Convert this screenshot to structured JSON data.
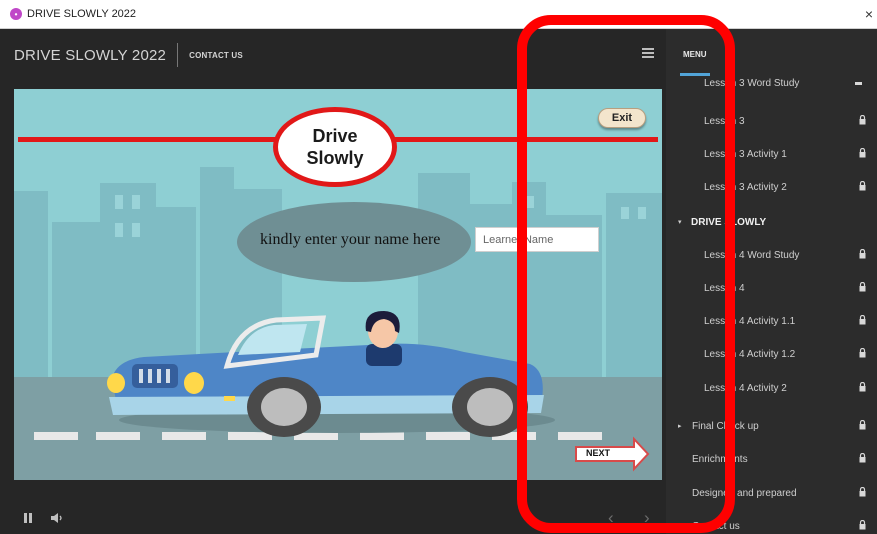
{
  "window": {
    "title": "DRIVE SLOWLY 2022",
    "close_glyph": "×"
  },
  "player": {
    "course_title": "DRIVE SLOWLY 2022",
    "contact_label": "CONTACT US",
    "menu_icon": "hamburger-icon"
  },
  "slide": {
    "title_lines": [
      "Drive",
      "Slowly"
    ],
    "exit_label": "Exit",
    "prompt": "kindly enter your name here",
    "name_input_placeholder": "Learner Name",
    "name_input_value": "",
    "next_label": "NEXT"
  },
  "controls": {
    "prev_glyph": "‹",
    "next_glyph": "›"
  },
  "menu": {
    "title": "MENU",
    "items": [
      {
        "label": "Lesson 3 Word Study",
        "locked": false
      },
      {
        "label": "Lesson 3",
        "locked": true
      },
      {
        "label": "Lesson 3 Activity 1",
        "locked": true
      },
      {
        "label": "Lesson 3 Activity 2",
        "locked": true
      },
      {
        "label": "DRIVE SLOWLY",
        "locked": false,
        "section": true,
        "expanded": true
      },
      {
        "label": "Lesson 4 Word Study",
        "locked": true
      },
      {
        "label": "Lesson 4",
        "locked": true
      },
      {
        "label": "Lesson 4 Activity 1.1",
        "locked": true
      },
      {
        "label": "Lesson 4 Activity 1.2",
        "locked": true
      },
      {
        "label": "Lesson 4 Activity 2",
        "locked": true
      },
      {
        "label": "Final Check up",
        "locked": true,
        "section": true,
        "expanded": false
      },
      {
        "label": "Enrichments",
        "locked": true
      },
      {
        "label": "Designed and prepared",
        "locked": true
      },
      {
        "label": "Contact us",
        "locked": true
      }
    ]
  },
  "colors": {
    "annotation": "#ff0000",
    "menu_accent": "#52a4d8",
    "title_ring": "#e11818"
  }
}
